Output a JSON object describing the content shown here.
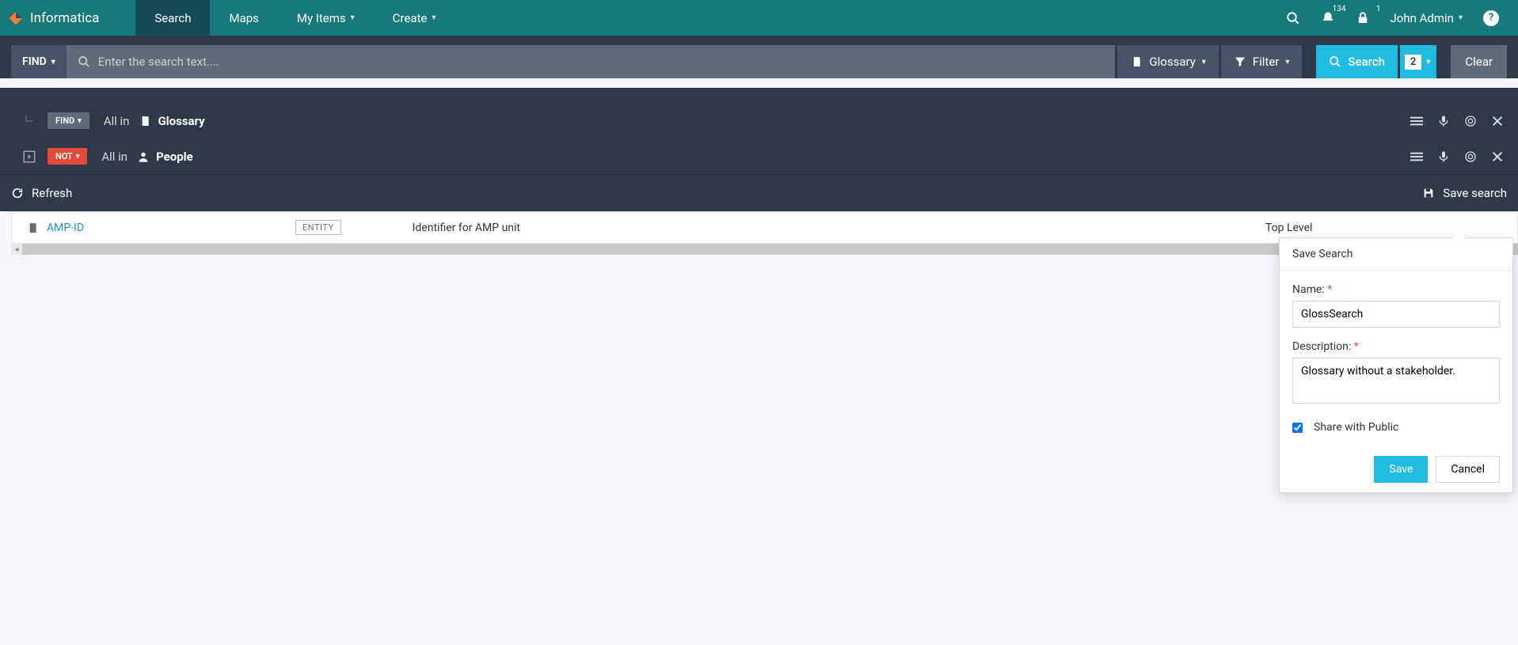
{
  "brand": "Informatica",
  "nav": {
    "tabs": [
      "Search",
      "Maps",
      "My Items",
      "Create"
    ],
    "notif_count": "134",
    "lock_count": "1",
    "user": "John Admin"
  },
  "searchbar": {
    "find_label": "FIND",
    "placeholder": "Enter the search text....",
    "glossary_label": "Glossary",
    "filter_label": "Filter",
    "search_label": "Search",
    "count": "2",
    "clear_label": "Clear"
  },
  "filters": {
    "row1": {
      "chip": "FIND",
      "allin": "All in",
      "scope": "Glossary"
    },
    "row2": {
      "chip": "NOT",
      "allin": "All in",
      "scope": "People"
    }
  },
  "actions": {
    "refresh": "Refresh",
    "save_search": "Save search"
  },
  "result": {
    "name": "AMP-ID",
    "tag": "ENTITY",
    "desc": "Identifier for AMP unit",
    "level": "Top Level"
  },
  "popover": {
    "title": "Save Search",
    "name_label": "Name:",
    "name_value": "GlossSearch",
    "desc_label": "Description:",
    "desc_value": "Glossary without a stakeholder.",
    "share_label": "Share with Public",
    "save": "Save",
    "cancel": "Cancel"
  }
}
